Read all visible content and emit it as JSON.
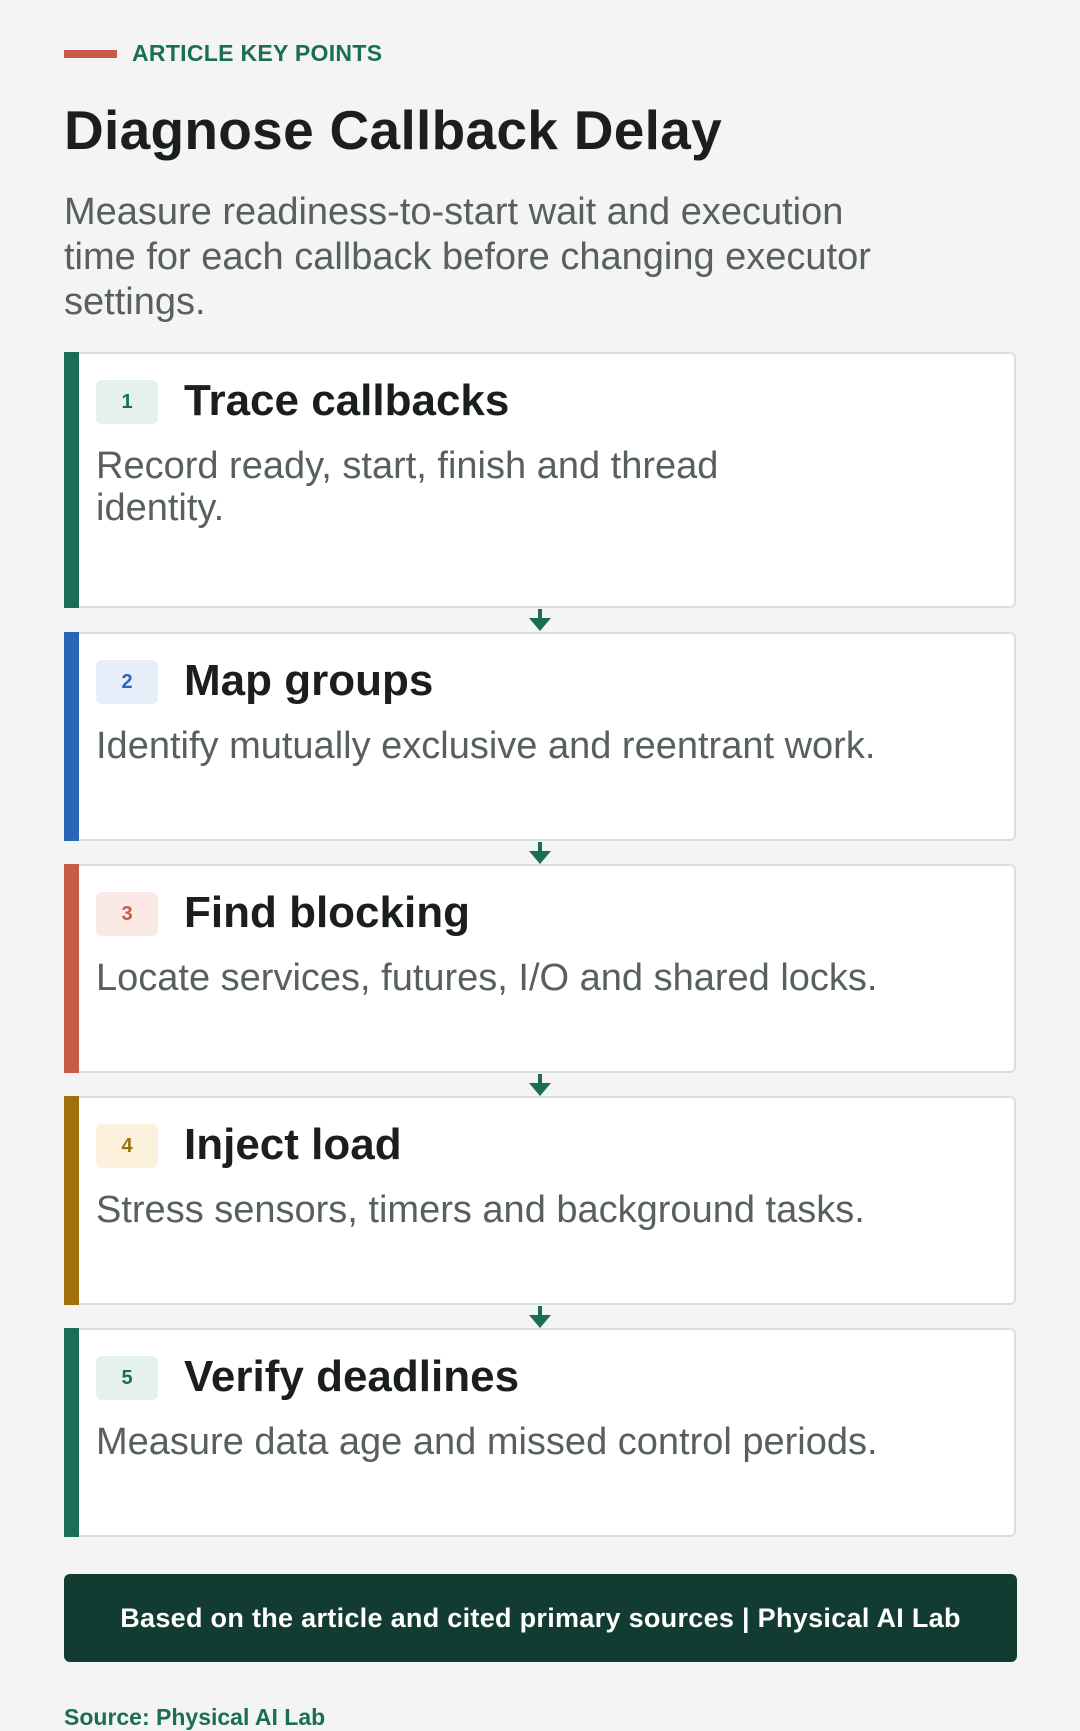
{
  "header": {
    "kicker": "ARTICLE KEY POINTS",
    "title": "Diagnose Callback Delay",
    "subtitle": "Measure readiness-to-start wait and execution time for each callback before changing executor settings."
  },
  "steps": [
    {
      "number": "1",
      "title": "Trace callbacks",
      "description": "Record ready, start, finish and thread identity.",
      "accent_color": "#1b6e56",
      "badge_bg": "#e4f1ec",
      "badge_color": "#1b6e56"
    },
    {
      "number": "2",
      "title": "Map groups",
      "description": "Identify mutually exclusive and reentrant work.",
      "accent_color": "#2a65b8",
      "badge_bg": "#e6eff9",
      "badge_color": "#2a65b8"
    },
    {
      "number": "3",
      "title": "Find blocking",
      "description": "Locate services, futures, I/O and shared locks.",
      "accent_color": "#c85a48",
      "badge_bg": "#fbe9e6",
      "badge_color": "#c85a48"
    },
    {
      "number": "4",
      "title": "Inject load",
      "description": "Stress sensors, timers and background tasks.",
      "accent_color": "#a0700f",
      "badge_bg": "#fbf1dd",
      "badge_color": "#a0700f"
    },
    {
      "number": "5",
      "title": "Verify deadlines",
      "description": "Measure data age and missed control periods.",
      "accent_color": "#1b6e56",
      "badge_bg": "#e4f1ec",
      "badge_color": "#1b6e56"
    }
  ],
  "connector_color": "#1b6e56",
  "footer": {
    "band_text": "Based on the article and cited primary sources | Physical AI Lab",
    "source": "Source: Physical AI Lab"
  }
}
